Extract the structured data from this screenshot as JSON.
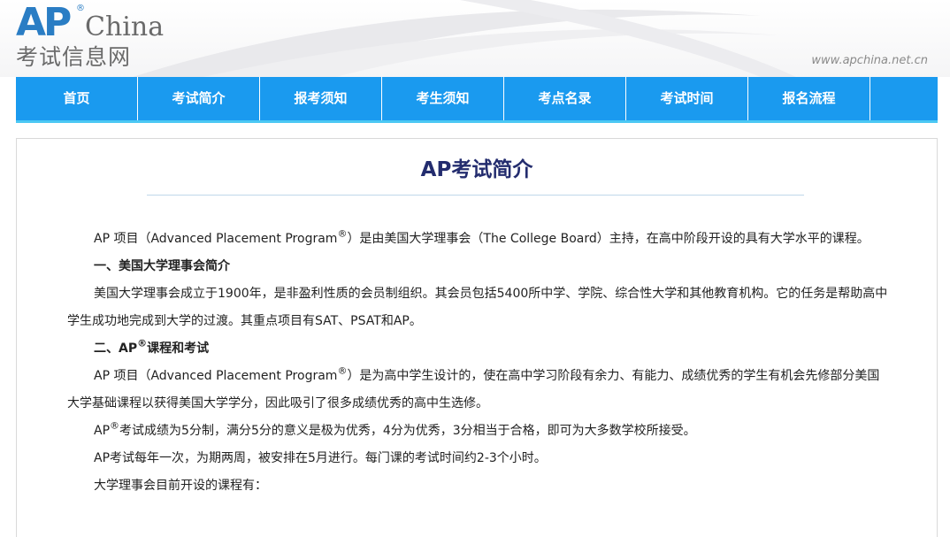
{
  "header": {
    "logo_ap": "AP",
    "logo_registered": "®",
    "logo_china": "China",
    "logo_subtitle": "考试信息网",
    "site_url": "www.apchina.net.cn"
  },
  "nav": {
    "items": [
      {
        "label": "首页"
      },
      {
        "label": "考试简介"
      },
      {
        "label": "报考须知"
      },
      {
        "label": "考生须知"
      },
      {
        "label": "考点名录"
      },
      {
        "label": "考试时间"
      },
      {
        "label": "报名流程"
      }
    ]
  },
  "article": {
    "title": "AP考试简介",
    "intro_a": "AP 项目（Advanced Placement Program",
    "intro_reg": "®",
    "intro_b": "）是由美国大学理事会（The College Board）主持，在高中阶段开设的具有大学水平的课程。",
    "section1_heading": "一、美国大学理事会简介",
    "section1_text": "美国大学理事会成立于1900年，是非盈利性质的会员制组织。其会员包括5400所中学、学院、综合性大学和其他教育机构。它的任务是帮助高中学生成功地完成到大学的过渡。其重点项目有SAT、PSAT和AP。",
    "section2_heading_a": "二、AP",
    "section2_heading_reg": "®",
    "section2_heading_b": "课程和考试",
    "section2_p1_a": "AP 项目（Advanced Placement Program",
    "section2_p1_reg": "®",
    "section2_p1_b": "）是为高中学生设计的，使在高中学习阶段有余力、有能力、成绩优秀的学生有机会先修部分美国大学基础课程以获得美国大学学分，因此吸引了很多成绩优秀的高中生选修。",
    "section2_p2_a": "AP",
    "section2_p2_reg": "®",
    "section2_p2_b": "考试成绩为5分制，满分5分的意义是极为优秀，4分为优秀，3分相当于合格，即可为大多数学校所接受。",
    "section2_p3": "AP考试每年一次，为期两周，被安排在5月进行。每门课的考试时间约2-3个小时。",
    "section2_p4": "大学理事会目前开设的课程有："
  },
  "colors": {
    "nav_bg": "#1a9aef",
    "nav_underline": "#4cc8f4",
    "title": "#232c6e",
    "logo_blue": "#2a7dc4"
  }
}
